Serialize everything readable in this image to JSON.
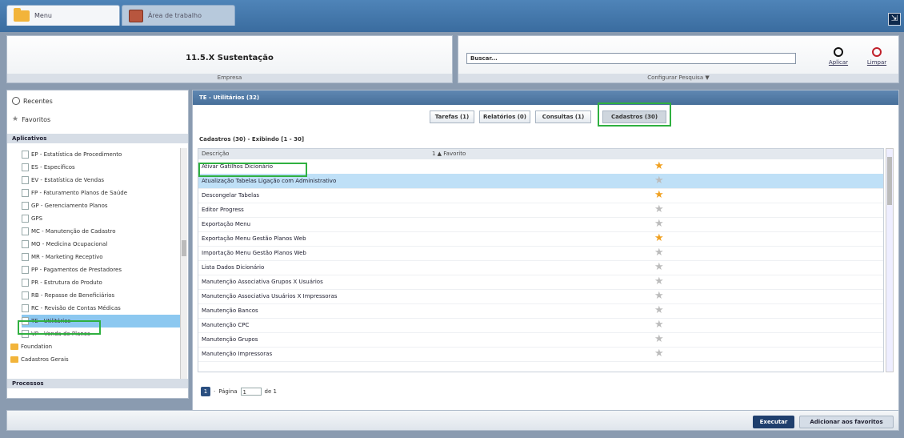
{
  "tabs": [
    {
      "label": "Menu",
      "icon": "folder-icon"
    },
    {
      "label": "Área de trabalho",
      "icon": "desktop-icon"
    }
  ],
  "company": {
    "name": "11.5.X Sustentação",
    "sublabel": "Empresa"
  },
  "search": {
    "placeholder": "Buscar...",
    "value": "",
    "apply_label": "Aplicar",
    "clear_label": "Limpar",
    "config_label": "Configurar Pesquisa ▼"
  },
  "sidebar": {
    "recent_label": "Recentes",
    "favorites_label": "Favoritos",
    "apps_header": "Aplicativos",
    "processes_header": "Processos",
    "items": [
      {
        "label": "EP - Estatística de Procedimento",
        "type": "doc"
      },
      {
        "label": "ES - Específicos",
        "type": "doc"
      },
      {
        "label": "EV - Estatística de Vendas",
        "type": "doc"
      },
      {
        "label": "FP - Faturamento Planos de Saúde",
        "type": "doc"
      },
      {
        "label": "GP - Gerenciamento Planos",
        "type": "doc"
      },
      {
        "label": "GPS",
        "type": "doc"
      },
      {
        "label": "MC - Manutenção de Cadastro",
        "type": "doc"
      },
      {
        "label": "MO - Medicina Ocupacional",
        "type": "doc"
      },
      {
        "label": "MR - Marketing Receptivo",
        "type": "doc"
      },
      {
        "label": "PP - Pagamentos de Prestadores",
        "type": "doc"
      },
      {
        "label": "PR - Estrutura do Produto",
        "type": "doc"
      },
      {
        "label": "RB - Repasse de Beneficiários",
        "type": "doc"
      },
      {
        "label": "RC - Revisão de Contas Médicas",
        "type": "doc"
      },
      {
        "label": "TE - Utilitários",
        "type": "doc",
        "selected": true
      },
      {
        "label": "VP - Venda de Planos",
        "type": "doc"
      },
      {
        "label": "Foundation",
        "type": "folder"
      },
      {
        "label": "Cadastros Gerais",
        "type": "folder"
      }
    ]
  },
  "main": {
    "title": "TE - Utilitários (32)",
    "tabs": [
      {
        "label": "Tarefas (1)",
        "active": false
      },
      {
        "label": "Relatórios (0)",
        "active": false
      },
      {
        "label": "Consultas (1)",
        "active": false
      },
      {
        "label": "Cadastros (30)",
        "active": true
      }
    ],
    "list_header": "Cadastros (30) - Exibindo [1 - 30]",
    "columns": {
      "description": "Descrição",
      "favorite": "1 ▲ Favorito"
    },
    "rows": [
      {
        "description": "Ativar Gatilhos Dicionário",
        "favorite": true
      },
      {
        "description": "Atualização Tabelas Ligação com Administrativo",
        "favorite": false,
        "selected": true
      },
      {
        "description": "Descongelar Tabelas",
        "favorite": true
      },
      {
        "description": "Editor Progress",
        "favorite": false
      },
      {
        "description": "Exportação Menu",
        "favorite": false
      },
      {
        "description": "Exportação Menu Gestão Planos Web",
        "favorite": true
      },
      {
        "description": "Importação Menu Gestão Planos Web",
        "favorite": false
      },
      {
        "description": "Lista Dados Dicionário",
        "favorite": false
      },
      {
        "description": "Manutenção Associativa Grupos X Usuários",
        "favorite": false
      },
      {
        "description": "Manutenção Associativa Usuários X Impressoras",
        "favorite": false
      },
      {
        "description": "Manutenção Bancos",
        "favorite": false
      },
      {
        "description": "Manutenção CPC",
        "favorite": false
      },
      {
        "description": "Manutenção Grupos",
        "favorite": false
      },
      {
        "description": "Manutenção Impressoras",
        "favorite": false
      }
    ],
    "pager": {
      "current": "1",
      "page_label": "Página",
      "page_value": "1",
      "of_label": "de 1"
    }
  },
  "footer": {
    "execute_label": "Executar",
    "add_favorites_label": "Adicionar aos favoritos"
  },
  "colors": {
    "accent": "#2fb040",
    "selected_row": "#bfe0f7",
    "star_on": "#f0a020"
  }
}
